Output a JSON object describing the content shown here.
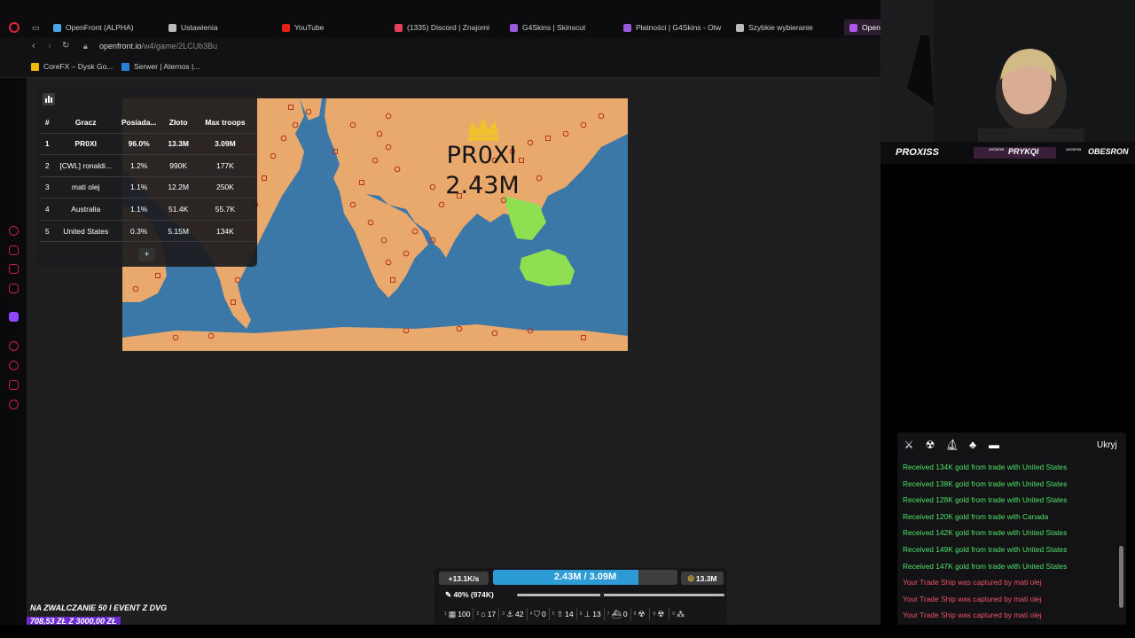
{
  "browser": {
    "tabs": [
      {
        "label": "OpenFront (ALPHA)",
        "icon": "openfront-icon",
        "color": "#4aa7e8"
      },
      {
        "label": "Ustawienia",
        "icon": "gear-icon",
        "color": "#bbbbbb"
      },
      {
        "label": "YouTube",
        "icon": "youtube-icon",
        "color": "#e62117"
      },
      {
        "label": "(1335) Discord | Znajomi",
        "icon": "discord-icon",
        "color": "#e8405a"
      },
      {
        "label": "G4Skins | Skinscut",
        "icon": "g4skins-icon",
        "color": "#9b59e0"
      },
      {
        "label": "Płatności | G4Skins - Otw",
        "icon": "g4skins-icon",
        "color": "#9b59e0"
      },
      {
        "label": "Szybkie wybieranie",
        "icon": "speed-dial-icon",
        "color": "#bbbbbb"
      },
      {
        "label": "OpenF",
        "icon": "openfront-icon",
        "color": "#b056e8"
      }
    ],
    "url_host": "openfront.io",
    "url_path": "/w4/game/2LCUb3Bu",
    "bookmarks": [
      {
        "label": "CoreFX – Dysk Go...",
        "icon": "drive-icon",
        "color": "#f2b705"
      },
      {
        "label": "Serwer | Aternos |...",
        "icon": "aternos-icon",
        "color": "#2c7fd6"
      }
    ]
  },
  "map": {
    "player_name": "PR0XI",
    "player_troops": "2.43M",
    "ocean_color": "#3b78a8",
    "land_color": "#e7a86f",
    "player_color": "#f0ad70",
    "ally_color": "#8fe052"
  },
  "leaderboard": {
    "columns": [
      "#",
      "Gracz",
      "Posiada...",
      "Złoto",
      "Max troops"
    ],
    "rows": [
      [
        "1",
        "PR0XI",
        "96.0%",
        "13.3M",
        "3.09M"
      ],
      [
        "2",
        "[CWL] ronaldi...",
        "1.2%",
        "990K",
        "177K"
      ],
      [
        "3",
        "mati olej",
        "1.1%",
        "12.2M",
        "250K"
      ],
      [
        "4",
        "Australia",
        "1.1%",
        "51.4K",
        "55.7K"
      ],
      [
        "5",
        "United States",
        "0.3%",
        "5.15M",
        "134K"
      ]
    ],
    "more_label": "+"
  },
  "webcam": {
    "name_main": "PROXISS",
    "name_2_small": "OSTATNI",
    "name_2": "PRYKQI",
    "name_3_small": "OSTATNI",
    "name_3": "OBESRON"
  },
  "events": {
    "hide_label": "Ukryj",
    "tool_icons": [
      "sword-icon",
      "nuke-icon",
      "boat-icon",
      "handshake-icon",
      "chat-icon"
    ],
    "lines": [
      {
        "text": "Received 134K gold from trade with United States",
        "color": "#4fe36a"
      },
      {
        "text": "Received 138K gold from trade with United States",
        "color": "#4fe36a"
      },
      {
        "text": "Received 128K gold from trade with United States",
        "color": "#4fe36a"
      },
      {
        "text": "Received 120K gold from trade with Canada",
        "color": "#4fe36a"
      },
      {
        "text": "Received 142K gold from trade with United States",
        "color": "#4fe36a"
      },
      {
        "text": "Received 149K gold from trade with United States",
        "color": "#4fe36a"
      },
      {
        "text": "Received 147K gold from trade with United States",
        "color": "#4fe36a"
      },
      {
        "text": "Your Trade Ship was captured by mati olej",
        "color": "#f0506a"
      },
      {
        "text": "Your Trade Ship was captured by mati olej",
        "color": "#f0506a"
      },
      {
        "text": "Your Trade Ship was captured by mati olej",
        "color": "#f0506a"
      }
    ]
  },
  "control": {
    "troop_gain": "+13.1K/s",
    "troops": "2.43M / 3.09M",
    "troop_fill_fraction": 0.7864,
    "gold": "13.3M",
    "attack_ratio": "40% (974K)",
    "slider_fraction": 0.4,
    "units": [
      {
        "label": "100",
        "icon": "city-icon",
        "key": "1"
      },
      {
        "label": "17",
        "icon": "factory-icon",
        "key": "2"
      },
      {
        "label": "42",
        "icon": "port-icon",
        "key": "3"
      },
      {
        "label": "0",
        "icon": "defense-post-icon",
        "key": "4"
      },
      {
        "label": "14",
        "icon": "missile-silo-icon",
        "key": "5"
      },
      {
        "label": "13",
        "icon": "sam-launcher-icon",
        "key": "6"
      },
      {
        "label": "0",
        "icon": "warship-icon",
        "key": "7"
      },
      {
        "label": "",
        "icon": "atom-bomb-icon",
        "key": "8"
      },
      {
        "label": "",
        "icon": "hydrogen-bomb-icon",
        "key": "9"
      },
      {
        "label": "",
        "icon": "mirv-icon",
        "key": "0"
      }
    ]
  },
  "stream_overlay": {
    "donation_title": "NA ZWALCZANIE 50 I EVENT Z DVG",
    "donation_amount": "708,53 ZŁ  Z  3000,00 ZŁ"
  }
}
